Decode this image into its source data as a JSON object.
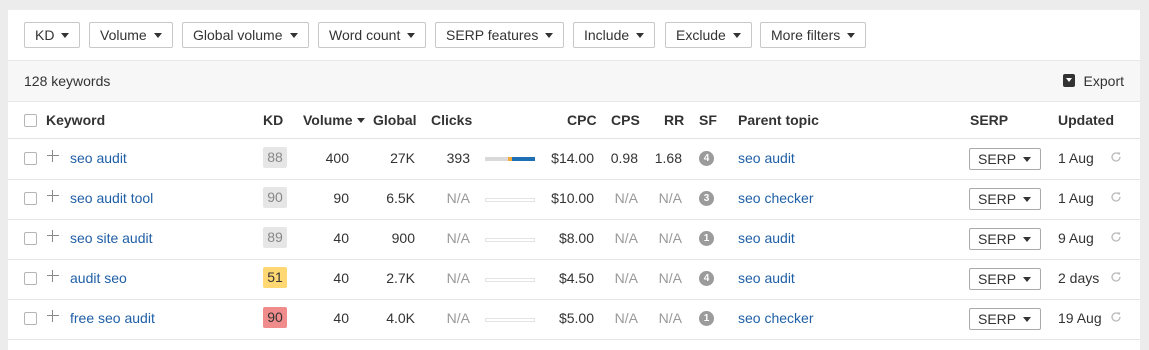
{
  "filters": [
    "KD",
    "Volume",
    "Global volume",
    "Word count",
    "SERP features",
    "Include",
    "Exclude",
    "More filters"
  ],
  "summary": {
    "count": "128 keywords",
    "export": "Export"
  },
  "columns": {
    "keyword": "Keyword",
    "kd": "KD",
    "volume": "Volume",
    "global": "Global",
    "clicks": "Clicks",
    "cpc": "CPC",
    "cps": "CPS",
    "rr": "RR",
    "sf": "SF",
    "parent": "Parent topic",
    "serp": "SERP",
    "updated": "Updated"
  },
  "colors": {
    "link": "#1f5fa6",
    "kd_gray": "#e6e6e6",
    "kd_yellow": "#ffd873",
    "kd_red": "#f08c8c",
    "bar_blue": "#1f6fb5",
    "bar_orange": "#f2a93b"
  },
  "rows": [
    {
      "keyword": "seo audit",
      "kd": "88",
      "kd_color": "gray",
      "volume": "400",
      "global": "27K",
      "clicks": "393",
      "clicks_bar": {
        "paid_fraction": 0.5,
        "organic_fraction": 0.45
      },
      "cpc": "$14.00",
      "cps": "0.98",
      "rr": "1.68",
      "sf": "4",
      "parent": "seo audit",
      "serp": "SERP",
      "updated": "1 Aug"
    },
    {
      "keyword": "seo audit tool",
      "kd": "90",
      "kd_color": "gray",
      "volume": "90",
      "global": "6.5K",
      "clicks": "N/A",
      "cpc": "$10.00",
      "cps": "N/A",
      "rr": "N/A",
      "sf": "3",
      "parent": "seo checker",
      "serp": "SERP",
      "updated": "1 Aug"
    },
    {
      "keyword": "seo site audit",
      "kd": "89",
      "kd_color": "gray",
      "volume": "40",
      "global": "900",
      "clicks": "N/A",
      "cpc": "$8.00",
      "cps": "N/A",
      "rr": "N/A",
      "sf": "1",
      "parent": "seo audit",
      "serp": "SERP",
      "updated": "9 Aug"
    },
    {
      "keyword": "audit seo",
      "kd": "51",
      "kd_color": "yellow",
      "volume": "40",
      "global": "2.7K",
      "clicks": "N/A",
      "cpc": "$4.50",
      "cps": "N/A",
      "rr": "N/A",
      "sf": "4",
      "parent": "seo audit",
      "serp": "SERP",
      "updated": "2 days"
    },
    {
      "keyword": "free seo audit",
      "kd": "90",
      "kd_color": "red",
      "volume": "40",
      "global": "4.0K",
      "clicks": "N/A",
      "cpc": "$5.00",
      "cps": "N/A",
      "rr": "N/A",
      "sf": "1",
      "parent": "seo checker",
      "serp": "SERP",
      "updated": "19 Aug"
    }
  ]
}
